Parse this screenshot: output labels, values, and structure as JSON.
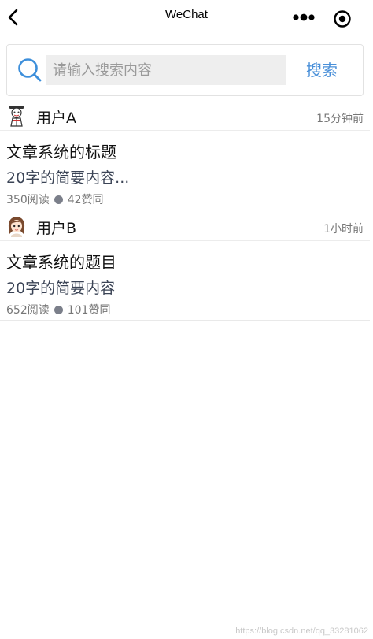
{
  "navbar": {
    "title": "WeChat",
    "back_icon": "chevron-left-icon",
    "more_icon": "more-dots-icon",
    "close_icon": "capsule-close-icon"
  },
  "search": {
    "placeholder": "请输入搜索内容",
    "value": "",
    "button_label": "搜索",
    "accent_color": "#4a90d9"
  },
  "articles": [
    {
      "author": "用户A",
      "time": "15分钟前",
      "title": "文章系统的标题",
      "summary": "20字的简要内容...",
      "reads": "350阅读",
      "likes": "42赞同",
      "avatar_icon": "cartoon-avatar-icon"
    },
    {
      "author": "用户B",
      "time": "1小时前",
      "title": "文章系统的题目",
      "summary": "20字的简要内容",
      "reads": "652阅读",
      "likes": "101赞同",
      "avatar_icon": "girl-avatar-icon"
    }
  ],
  "watermark": "https://blog.csdn.net/qq_33281062"
}
